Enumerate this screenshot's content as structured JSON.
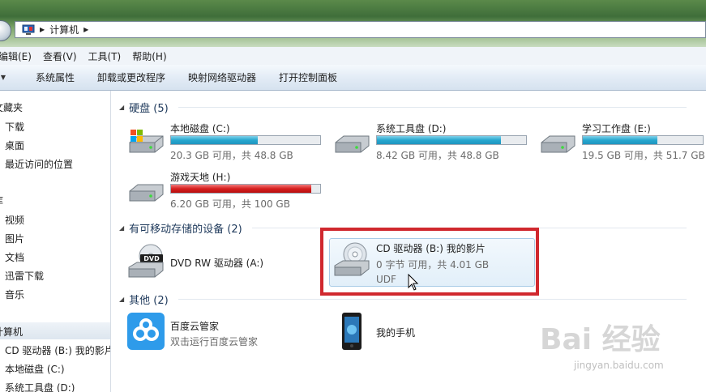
{
  "address": {
    "path": "计算机"
  },
  "menu": [
    "编辑(E)",
    "查看(V)",
    "工具(T)",
    "帮助(H)"
  ],
  "commands": [
    "系统属性",
    "卸载或更改程序",
    "映射网络驱动器",
    "打开控制面板"
  ],
  "nav": {
    "favorites": {
      "label": "文藏夹",
      "items": [
        "下载",
        "桌面",
        "最近访问的位置"
      ]
    },
    "libraries": {
      "label": "库",
      "items": [
        "视频",
        "图片",
        "文档",
        "迅雷下载",
        "音乐"
      ]
    },
    "computer": {
      "label": "计算机",
      "items": [
        "CD 驱动器 (B:) 我的影片",
        "本地磁盘 (C:)",
        "系统工具盘 (D:)"
      ]
    }
  },
  "groups": {
    "hard_disks": {
      "header": "硬盘 (5)",
      "drives": [
        {
          "name": "本地磁盘 (C:)",
          "size": "20.3 GB 可用，共 48.8 GB",
          "used_fraction": 0.58,
          "bar_color": "#27a7cf"
        },
        {
          "name": "系统工具盘 (D:)",
          "size": "8.42 GB 可用，共 48.8 GB",
          "used_fraction": 0.83,
          "bar_color": "#27a7cf"
        },
        {
          "name": "学习工作盘 (E:)",
          "size": "19.5 GB 可用，共 51.7 GB",
          "used_fraction": 0.62,
          "bar_color": "#27a7cf"
        },
        {
          "name": "游戏天地 (H:)",
          "size": "6.20 GB 可用，共 100 GB",
          "used_fraction": 0.94,
          "bar_color": "#d61f1f"
        }
      ]
    },
    "removable": {
      "header": "有可移动存储的设备 (2)",
      "dvd": {
        "name": "DVD RW 驱动器 (A:)"
      },
      "cd": {
        "name": "CD 驱动器 (B:) 我的影片",
        "size": "0 字节 可用，共 4.01 GB",
        "fs": "UDF"
      }
    },
    "other": {
      "header": "其他 (2)",
      "baidu": {
        "name": "百度云管家",
        "desc": "双击运行百度云管家"
      },
      "phone": {
        "name": "我的手机"
      }
    }
  },
  "watermark": {
    "brand": "Bai 经验",
    "url": "jingyan.baidu.com"
  }
}
